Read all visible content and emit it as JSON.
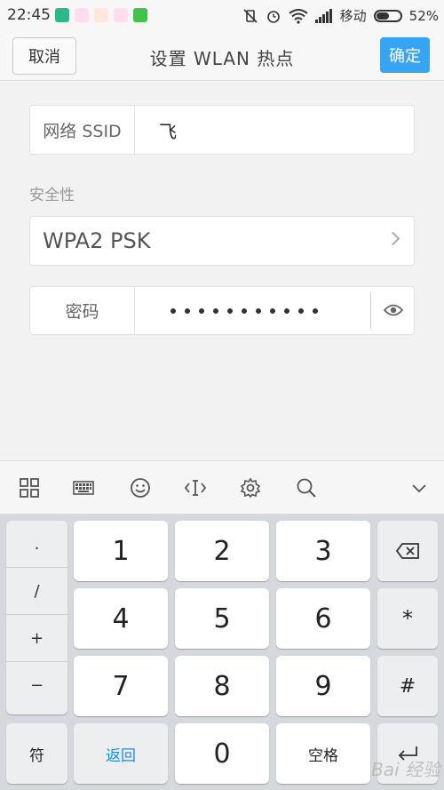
{
  "status_bar": {
    "time": "22:45",
    "carrier": "移动",
    "battery": "52%",
    "battery_level": 0.52,
    "app_icon_colors": [
      "#2db88a",
      "#ff4d4d",
      "#ff7a3c",
      "#ff4d4d",
      "#45c14a"
    ]
  },
  "header": {
    "cancel_label": "取消",
    "title": "设置 WLAN 热点",
    "confirm_label": "确定"
  },
  "form": {
    "ssid_label": "网络 SSID",
    "ssid_value": "飞",
    "security_section": "安全性",
    "security_value": "WPA2 PSK",
    "password_label": "密码",
    "password_mask_length": 11
  },
  "toolbar": {
    "icons": [
      "grid-icon",
      "keyboard-icon",
      "emoji-icon",
      "cursor-icon",
      "settings-icon",
      "search-icon",
      "collapse-icon"
    ]
  },
  "keyboard": {
    "symbols": [
      ".",
      "/",
      "+",
      "−"
    ],
    "digits": [
      "1",
      "2",
      "3",
      "4",
      "5",
      "6",
      "7",
      "8",
      "9",
      "0"
    ],
    "star": "*",
    "hash": "#",
    "fu_label": "符",
    "back_label": "返回",
    "space_label": "空格",
    "back_color": "#1e88e5"
  },
  "watermark": "Bai 经验"
}
